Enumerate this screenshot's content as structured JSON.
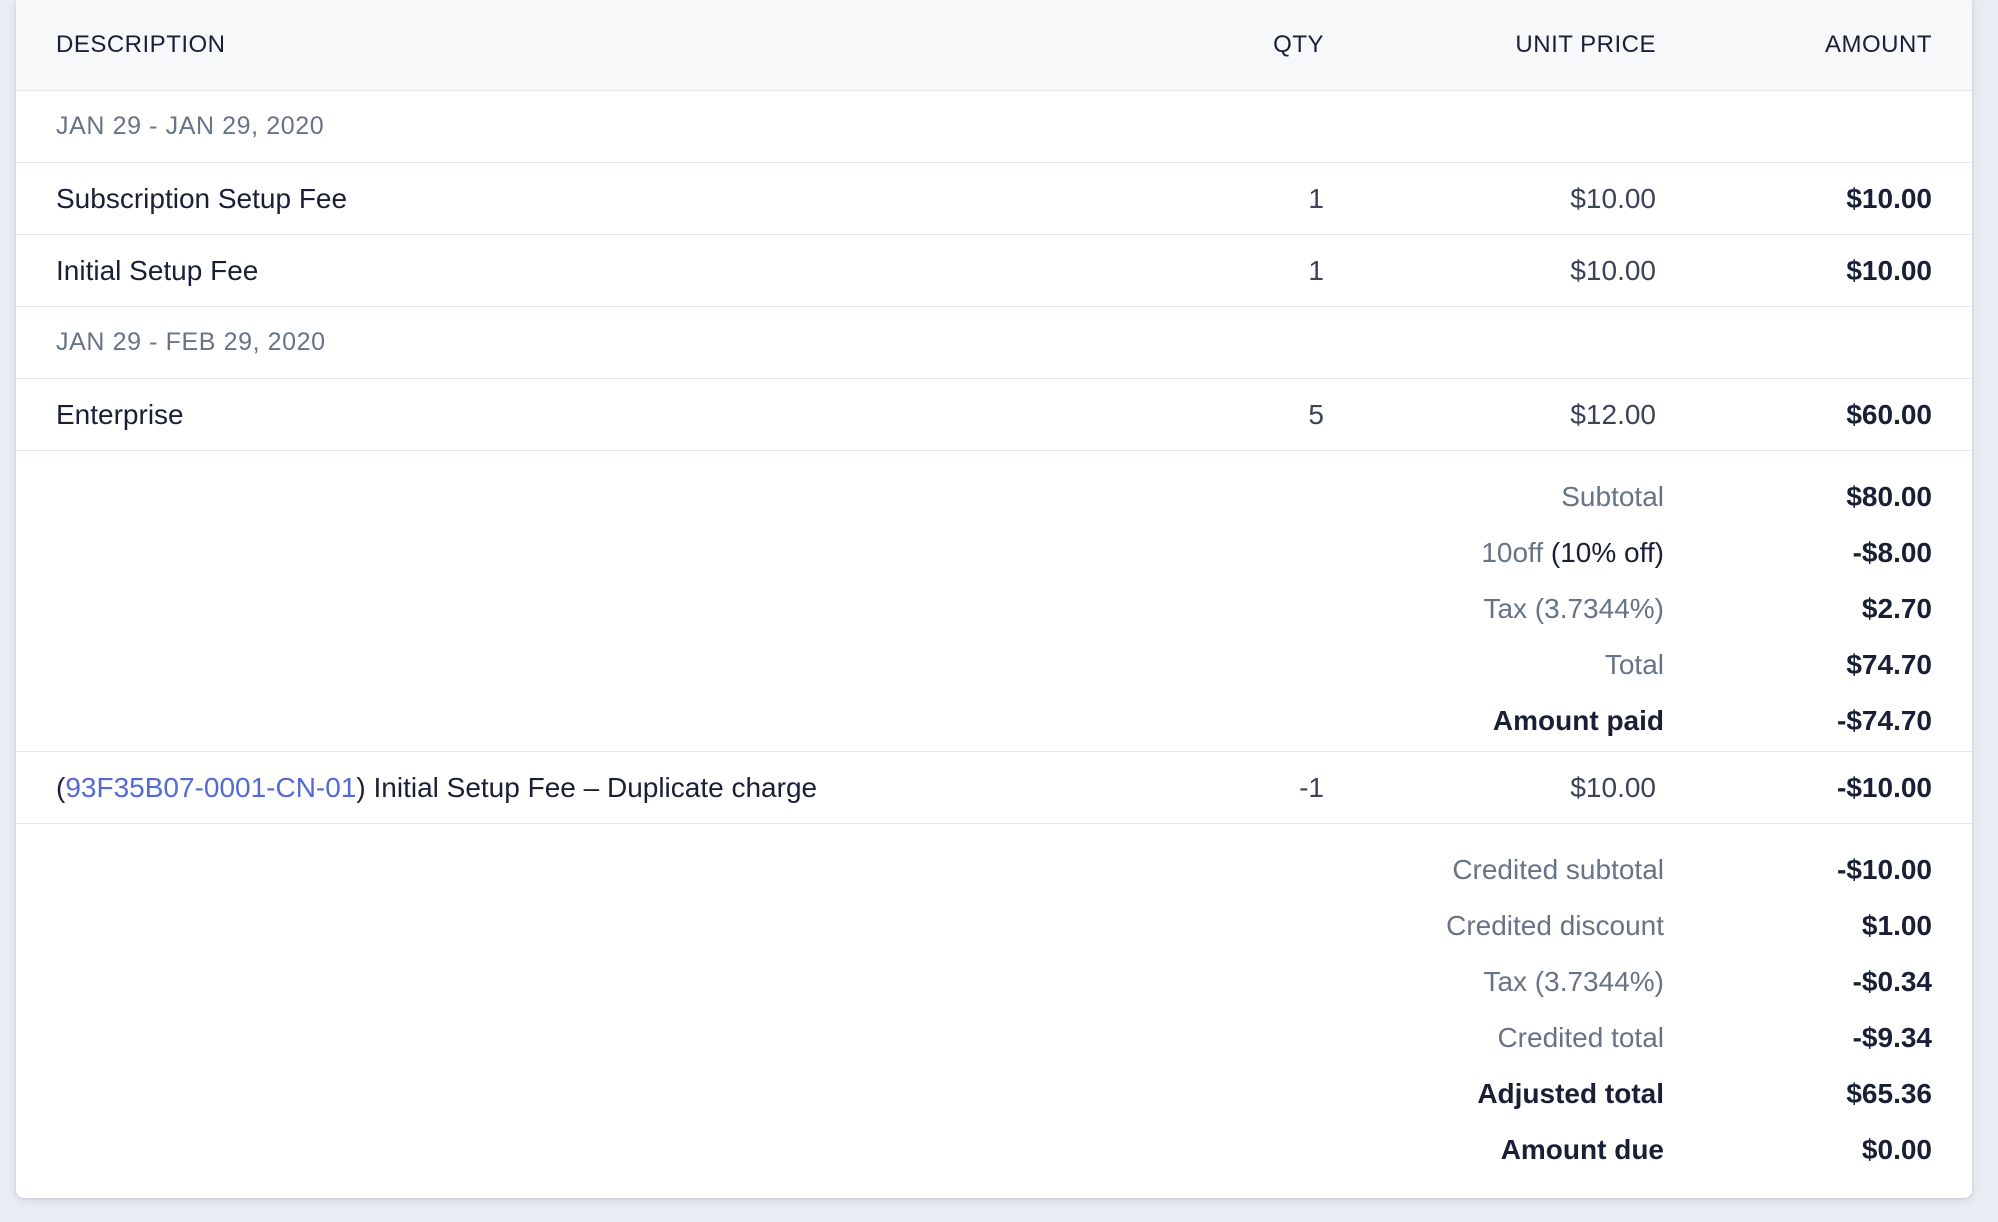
{
  "header": {
    "description": "DESCRIPTION",
    "qty": "QTY",
    "unit_price": "UNIT PRICE",
    "amount": "AMOUNT"
  },
  "groups": [
    {
      "date_range": "JAN 29 - JAN 29, 2020",
      "items": [
        {
          "description": "Subscription Setup Fee",
          "qty": "1",
          "unit_price": "$10.00",
          "amount": "$10.00"
        },
        {
          "description": "Initial Setup Fee",
          "qty": "1",
          "unit_price": "$10.00",
          "amount": "$10.00"
        }
      ]
    },
    {
      "date_range": "JAN 29 - FEB 29, 2020",
      "items": [
        {
          "description": "Enterprise",
          "qty": "5",
          "unit_price": "$12.00",
          "amount": "$60.00"
        }
      ]
    }
  ],
  "summary": {
    "subtotal_label": "Subtotal",
    "subtotal_value": "$80.00",
    "discount_code": "10off",
    "discount_detail": "(10% off)",
    "discount_value": "-$8.00",
    "tax_label": "Tax (3.7344%)",
    "tax_value": "$2.70",
    "total_label": "Total",
    "total_value": "$74.70",
    "amount_paid_label": "Amount paid",
    "amount_paid_value": "-$74.70"
  },
  "credit_line": {
    "open_paren": "(",
    "credit_note_id": "93F35B07-0001-CN-01",
    "close_text": ") Initial Setup Fee – Duplicate charge",
    "qty": "-1",
    "unit_price": "$10.00",
    "amount": "-$10.00"
  },
  "credit_summary": {
    "credited_subtotal_label": "Credited subtotal",
    "credited_subtotal_value": "-$10.00",
    "credited_discount_label": "Credited discount",
    "credited_discount_value": "$1.00",
    "tax_label": "Tax (3.7344%)",
    "tax_value": "-$0.34",
    "credited_total_label": "Credited total",
    "credited_total_value": "-$9.34",
    "adjusted_total_label": "Adjusted total",
    "adjusted_total_value": "$65.36",
    "amount_due_label": "Amount due",
    "amount_due_value": "$0.00"
  }
}
